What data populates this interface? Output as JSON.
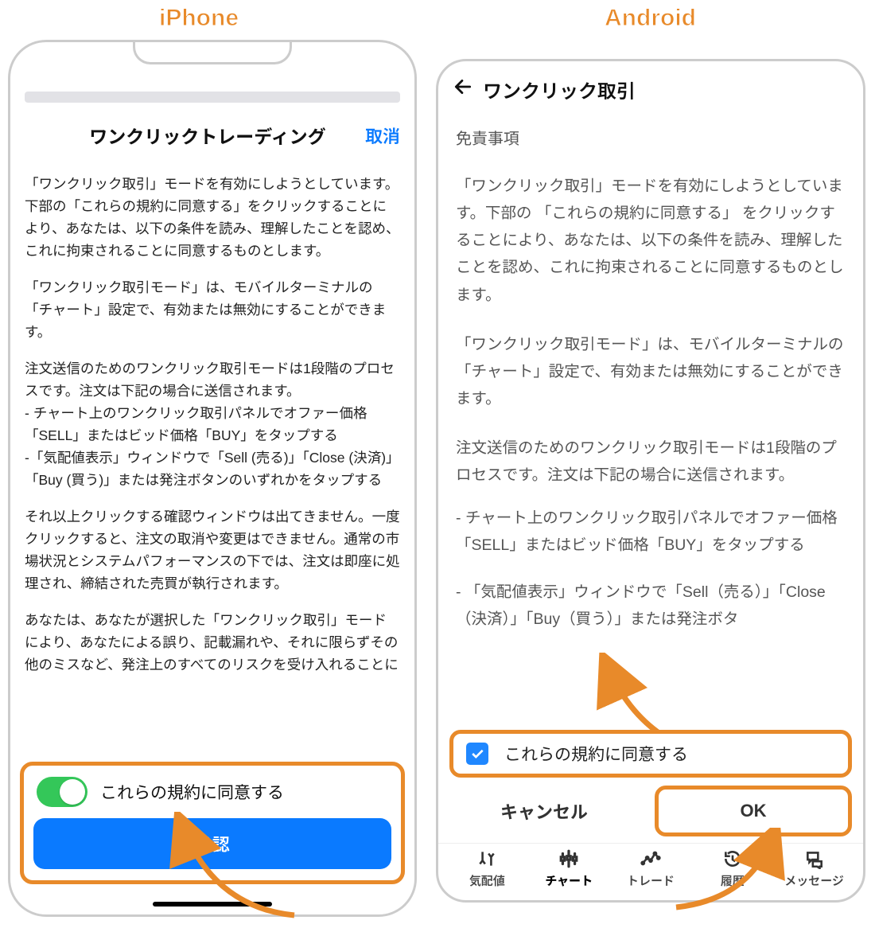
{
  "labels": {
    "iphone": "iPhone",
    "android": "Android"
  },
  "accent_orange": "#e88a2a",
  "iphone": {
    "title": "ワンクリックトレーディング",
    "cancel": "取消",
    "paragraphs": [
      "「ワンクリック取引」モードを有効にしようとしています。下部の「これらの規約に同意する」をクリックすることにより、あなたは、以下の条件を読み、理解したことを認め、これに拘束されることに同意するものとします。",
      "「ワンクリック取引モード」は、モバイルターミナルの「チャート」設定で、有効または無効にすることができます。",
      "注文送信のためのワンクリック取引モードは1段階のプロセスです。注文は下記の場合に送信されます。\n- チャート上のワンクリック取引パネルでオファー価格「SELL」またはビッド価格「BUY」をタップする\n-「気配値表示」ウィンドウで「Sell (売る)」「Close (決済)」「Buy (買う)」または発注ボタンのいずれかをタップする",
      "それ以上クリックする確認ウィンドウは出てきません。一度クリックすると、注文の取消や変更はできません。通常の市場状況とシステムパフォーマンスの下では、注文は即座に処理され、締結された売買が執行されます。",
      "あなたは、あなたが選択した「ワンクリック取引」モードにより、あなたによる誤り、記載漏れや、それに限らずその他のミスなど、発注上のすべてのリスクを受け入れることに"
    ],
    "agree_label": "これらの規約に同意する",
    "agree_on": true,
    "approve": "承認"
  },
  "android": {
    "title": "ワンクリック取引",
    "disclaimer_heading": "免責事項",
    "paragraphs": [
      "「ワンクリック取引」モードを有効にしようとしています。下部の 「これらの規約に同意する」 をクリックすることにより、あなたは、以下の条件を読み、理解したことを認め、これに拘束されることに同意するものとします。",
      "「ワンクリック取引モード」は、モバイルターミナルの「チャート」設定で、有効または無効にすることができます。",
      "注文送信のためのワンクリック取引モードは1段階のプロセスです。注文は下記の場合に送信されます。",
      "- チャート上のワンクリック取引パネルでオファー価格「SELL」またはビッド価格「BUY」をタップする",
      "- 「気配値表示」ウィンドウで「Sell（売る）」「Close（決済）」「Buy（買う）」または発注ボタ"
    ],
    "agree_label": "これらの規約に同意する",
    "agree_checked": true,
    "cancel": "キャンセル",
    "ok": "OK",
    "tabs": [
      {
        "icon": "quotes-icon",
        "label": "気配値"
      },
      {
        "icon": "chart-icon",
        "label": "チャート"
      },
      {
        "icon": "trade-icon",
        "label": "トレード"
      },
      {
        "icon": "history-icon",
        "label": "履歴"
      },
      {
        "icon": "message-icon",
        "label": "メッセージ"
      }
    ],
    "active_tab_index": 1
  }
}
